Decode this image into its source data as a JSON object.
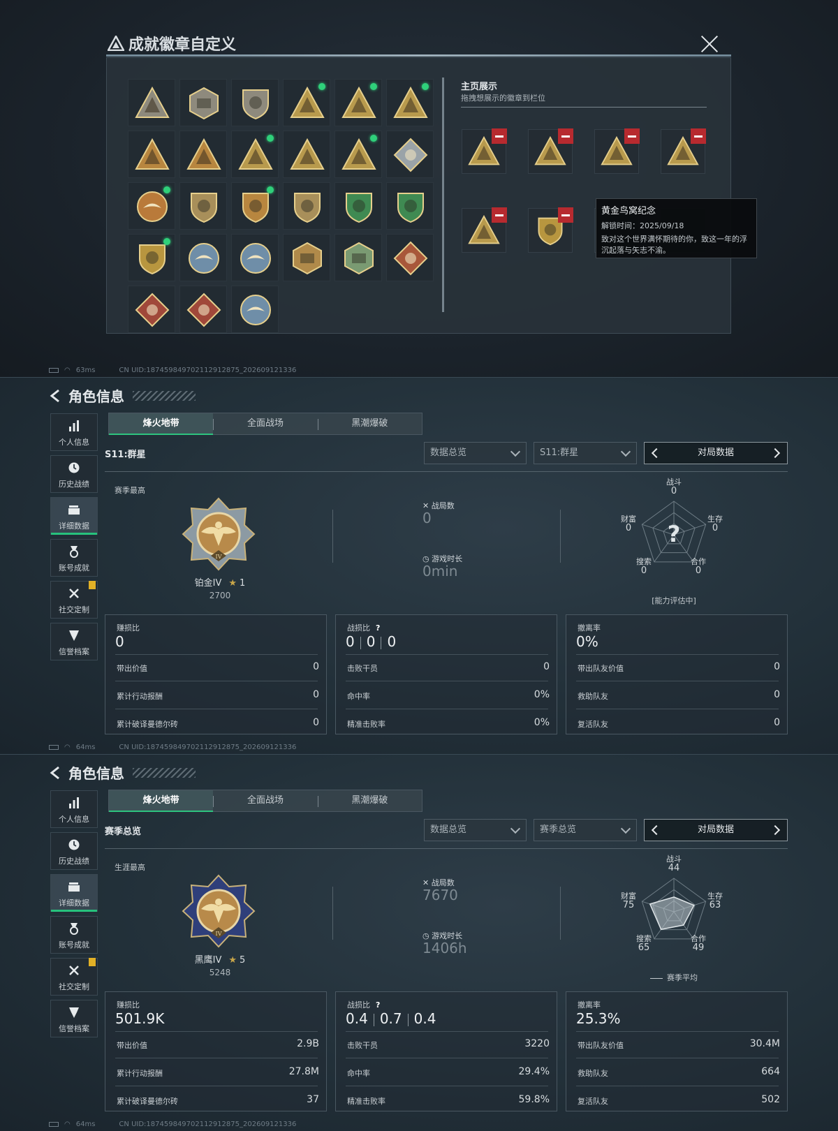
{
  "dialog": {
    "title": "成就徽章自定义",
    "showcase_title": "主页展示",
    "showcase_hint": "拖拽想展示的徽章到栏位",
    "badges": [
      {
        "icon": "triangle-emblem-icon",
        "c": "#8e8a7d",
        "shape": "tri",
        "new": false
      },
      {
        "icon": "helicopter-badge-icon",
        "c": "#8e8a7d",
        "shape": "hex",
        "new": false
      },
      {
        "icon": "diamond-shield-icon",
        "c": "#8e8a7d",
        "shape": "shield",
        "new": false
      },
      {
        "icon": "temple-badge-icon",
        "c": "#b89a4d",
        "shape": "tri",
        "new": true
      },
      {
        "icon": "number-58-badge-icon",
        "c": "#b89a4d",
        "shape": "tri",
        "new": true
      },
      {
        "icon": "golden-nest-badge-icon",
        "c": "#b89a4d",
        "shape": "tri",
        "new": true
      },
      {
        "icon": "rank-1-badge-icon",
        "c": "#b8863f",
        "shape": "tri",
        "new": false
      },
      {
        "icon": "rank-2-badge-icon",
        "c": "#b8863f",
        "shape": "tri",
        "new": false
      },
      {
        "icon": "soldier-badge-icon",
        "c": "#b89a4d",
        "shape": "tri",
        "new": true
      },
      {
        "icon": "operator-badge-icon",
        "c": "#b89a4d",
        "shape": "tri",
        "new": false
      },
      {
        "icon": "tower-badge-icon",
        "c": "#b89a4d",
        "shape": "tri",
        "new": true
      },
      {
        "icon": "silver-cube-badge-icon",
        "c": "#9aa3a8",
        "shape": "diamond",
        "new": false
      },
      {
        "icon": "star-medal-icon",
        "c": "#b97a3a",
        "shape": "round",
        "new": true
      },
      {
        "icon": "wing-shield-icon",
        "c": "#a88f5a",
        "shape": "shield",
        "new": false
      },
      {
        "icon": "stars-shield-badge-icon",
        "c": "#b8863f",
        "shape": "shield",
        "new": true
      },
      {
        "icon": "lion-shield-icon",
        "c": "#a88f5a",
        "shape": "shield",
        "new": false
      },
      {
        "icon": "green-rifle-badge-icon",
        "c": "#3f8a52",
        "shape": "shield",
        "new": false
      },
      {
        "icon": "green-sniper-badge-icon",
        "c": "#3f8a52",
        "shape": "shield",
        "new": false
      },
      {
        "icon": "crossed-guns-shield-icon",
        "c": "#b8963f",
        "shape": "shield",
        "new": true
      },
      {
        "icon": "eagle-round-badge-icon",
        "c": "#6f8ea8",
        "shape": "round",
        "new": false
      },
      {
        "icon": "eagle-blue-badge-icon",
        "c": "#6f8ea8",
        "shape": "round",
        "new": false
      },
      {
        "icon": "lion-square-badge-icon",
        "c": "#b08a4a",
        "shape": "hex",
        "new": false
      },
      {
        "icon": "bird-green-hex-icon",
        "c": "#7a9a72",
        "shape": "hex",
        "new": false
      },
      {
        "icon": "dragon-diamond-icon",
        "c": "#a8573a",
        "shape": "diamond",
        "new": false
      },
      {
        "icon": "dragon-red-diamond-icon",
        "c": "#a0483a",
        "shape": "diamond",
        "new": false
      },
      {
        "icon": "runner-red-diamond-icon",
        "c": "#a0483a",
        "shape": "diamond",
        "new": false
      },
      {
        "icon": "wolf-round-badge-icon",
        "c": "#6f8ea8",
        "shape": "round",
        "new": false
      }
    ],
    "slots": [
      {
        "icon": "temple-badge-icon",
        "c": "#b89a4d",
        "shape": "tri"
      },
      {
        "icon": "number-58-badge-icon",
        "c": "#b89a4d",
        "shape": "tri"
      },
      {
        "icon": "golden-nest-badge-icon",
        "c": "#b89a4d",
        "shape": "tri"
      },
      {
        "icon": "tower-badge-icon",
        "c": "#b89a4d",
        "shape": "tri"
      },
      {
        "icon": "soldier-badge-icon",
        "c": "#b89a4d",
        "shape": "tri"
      },
      {
        "icon": "crossed-guns-shield-icon",
        "c": "#b8963f",
        "shape": "shield"
      }
    ],
    "tooltip": {
      "name": "黄金鸟窝纪念",
      "unlock": "解锁时间：2025/09/18",
      "desc": "致对这个世界满怀期待的你，致这一年的浮沉起落与矢志不渝。"
    }
  },
  "statusbar": {
    "ping1": "63ms",
    "ping2": "64ms",
    "ping3": "64ms",
    "uid": "CN UID:1874598497021129128​75_202609121336"
  },
  "page": {
    "title": "角色信息",
    "sidebar": [
      "个人信息",
      "历史战绩",
      "详细数据",
      "账号成就",
      "社交定制",
      "信誉档案"
    ],
    "tabs": [
      "烽火地带",
      "全面战场",
      "黑潮爆破"
    ],
    "pager_label": "对局数据",
    "radar_labels": {
      "fight": "战斗",
      "survive": "生存",
      "coop": "合作",
      "search": "搜索",
      "wealth": "财富"
    },
    "matches_label": "战局数",
    "duration_label": "游戏时长",
    "card1": {
      "title": "赚损比",
      "rows": [
        "带出价值",
        "累计行动报酬",
        "累计破译曼德尔砖"
      ]
    },
    "card2": {
      "title": "战损比",
      "rows": [
        "击败干员",
        "命中率",
        "精准击败率"
      ]
    },
    "card3": {
      "title": "撤离率",
      "rows": [
        "带出队友价值",
        "救助队友",
        "复活队友"
      ]
    }
  },
  "s2": {
    "season": "S11:群星",
    "filter1": "数据总览",
    "filter2": "S11:群星",
    "best_label": "赛季最高",
    "rank": "铂金IV",
    "stars": "1",
    "score": "2700",
    "matches": "0",
    "duration": "0min",
    "radar": {
      "fight": "0",
      "survive": "0",
      "coop": "0",
      "search": "0",
      "wealth": "0",
      "note": "[能力评估中]"
    },
    "card1": {
      "big": "0",
      "v": [
        "0",
        "0",
        "0"
      ]
    },
    "card2": {
      "k1": "0",
      "k2": "0",
      "k3": "0",
      "v": [
        "0",
        "0%",
        "0%"
      ]
    },
    "card3": {
      "big": "0%",
      "v": [
        "0",
        "0",
        "0"
      ]
    }
  },
  "s3": {
    "season": "赛季总览",
    "filter1": "数据总览",
    "filter2": "赛季总览",
    "best_label": "生涯最高",
    "rank": "黑鹰IV",
    "stars": "5",
    "score": "5248",
    "matches": "7670",
    "duration": "1406h",
    "radar": {
      "fight": "44",
      "survive": "63",
      "coop": "49",
      "search": "65",
      "wealth": "75",
      "note": "赛季平均"
    },
    "radar_values": [
      44,
      63,
      49,
      65,
      75
    ],
    "card1": {
      "big": "501.9K",
      "v": [
        "2.9B",
        "27.8M",
        "37"
      ]
    },
    "card2": {
      "k1": "0.4",
      "k2": "0.7",
      "k3": "0.4",
      "v": [
        "3220",
        "29.4%",
        "59.8%"
      ]
    },
    "card3": {
      "big": "25.3%",
      "v": [
        "30.4M",
        "664",
        "502"
      ]
    }
  }
}
